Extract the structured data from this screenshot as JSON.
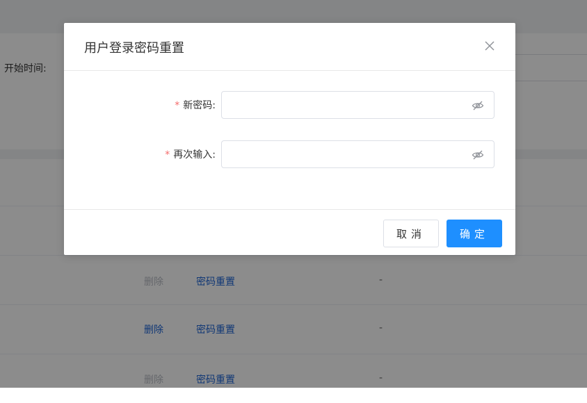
{
  "background": {
    "filter_label": "开始时间:",
    "rows": [
      {
        "delete_label": "删除",
        "delete_state": "disabled",
        "reset_label": "密码重置",
        "value": "-"
      },
      {
        "delete_label": "删除",
        "delete_state": "active",
        "reset_label": "密码重置",
        "value": "-"
      },
      {
        "delete_label": "删除",
        "delete_state": "disabled",
        "reset_label": "密码重置",
        "value": "-"
      }
    ]
  },
  "dialog": {
    "title": "用户登录密码重置",
    "close_icon": "close-icon",
    "fields": [
      {
        "required_mark": "*",
        "label": "新密码:",
        "value": "",
        "icon": "eye-off-icon"
      },
      {
        "required_mark": "*",
        "label": "再次输入:",
        "value": "",
        "icon": "eye-off-icon"
      }
    ],
    "cancel_label": "取消",
    "confirm_label": "确定"
  },
  "colors": {
    "primary": "#1e8fff",
    "link": "#1e64d6",
    "required": "#f56c6c",
    "disabled_text": "#b8bcc4"
  }
}
